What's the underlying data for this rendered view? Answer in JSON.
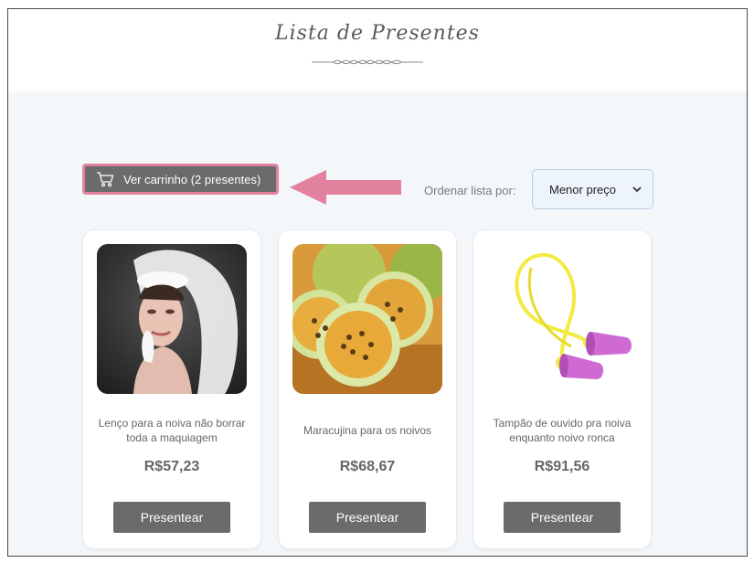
{
  "header": {
    "title": "Lista de Presentes"
  },
  "toolbar": {
    "cart_label": "Ver carrinho (2  presentes)",
    "sort_label": "Ordenar lista por:",
    "sort_selected": "Menor preço"
  },
  "products": [
    {
      "name": "Lenço para a noiva não borrar toda a maquiagem",
      "price": "R$57,23",
      "button": "Presentear"
    },
    {
      "name": "Maracujina para os noivos",
      "price": "R$68,67",
      "button": "Presentear"
    },
    {
      "name": "Tampão de ouvido pra noiva enquanto noivo ronca",
      "price": "R$91,56",
      "button": "Presentear"
    }
  ],
  "colors": {
    "button_bg": "#6b6b6b",
    "highlight_pink": "#e2829f",
    "page_bg": "#f4f7fa"
  },
  "icons": {
    "cart": "shopping-cart-icon",
    "arrow": "left-arrow-icon",
    "select": "chevron-down-icon"
  }
}
